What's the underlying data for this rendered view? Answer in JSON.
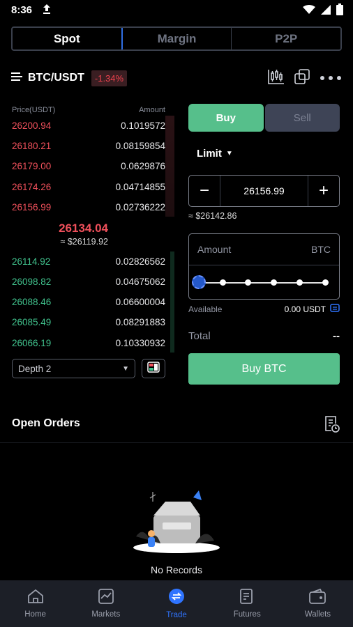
{
  "status_bar": {
    "time": "8:36"
  },
  "market_tabs": [
    {
      "label": "Spot",
      "active": true
    },
    {
      "label": "Margin",
      "active": false
    },
    {
      "label": "P2P",
      "active": false
    }
  ],
  "pair": {
    "symbol": "BTC/USDT",
    "change": "-1.34%"
  },
  "orderbook": {
    "price_header": "Price(USDT)",
    "amount_header": "Amount",
    "asks": [
      {
        "price": "26200.94",
        "amount": "0.1019572"
      },
      {
        "price": "26180.21",
        "amount": "0.08159854"
      },
      {
        "price": "26179.00",
        "amount": "0.0629876"
      },
      {
        "price": "26174.26",
        "amount": "0.04714855"
      },
      {
        "price": "26156.99",
        "amount": "0.02736222"
      }
    ],
    "last_price": "26134.04",
    "last_price_fiat": "≈ $26119.92",
    "bids": [
      {
        "price": "26114.92",
        "amount": "0.02826562"
      },
      {
        "price": "26098.82",
        "amount": "0.04675062"
      },
      {
        "price": "26088.46",
        "amount": "0.06600004"
      },
      {
        "price": "26085.49",
        "amount": "0.08291883"
      },
      {
        "price": "26066.19",
        "amount": "0.10330932"
      }
    ],
    "depth_label": "Depth 2"
  },
  "trade_form": {
    "buy_label": "Buy",
    "sell_label": "Sell",
    "order_type": "Limit",
    "price_value": "26156.99",
    "price_fiat": "≈ $26142.86",
    "amount_label": "Amount",
    "amount_unit": "BTC",
    "amount_slider_percent": 0,
    "available_label": "Available",
    "available_value": "0.00 USDT",
    "total_label": "Total",
    "total_value": "--",
    "submit_label": "Buy BTC"
  },
  "open_orders": {
    "title": "Open Orders",
    "empty_text": "No Records"
  },
  "bottom_nav": [
    {
      "label": "Home",
      "icon": "home-icon"
    },
    {
      "label": "Markets",
      "icon": "markets-icon"
    },
    {
      "label": "Trade",
      "icon": "trade-icon",
      "active": true
    },
    {
      "label": "Futures",
      "icon": "futures-icon"
    },
    {
      "label": "Wallets",
      "icon": "wallet-icon"
    }
  ],
  "colors": {
    "accent": "#2f74ff",
    "buy": "#56bf8b",
    "ask": "#f0505b",
    "bid": "#41c28d"
  }
}
